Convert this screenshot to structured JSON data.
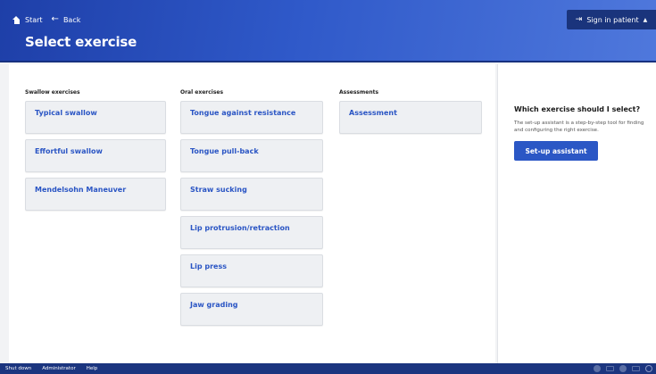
{
  "header": {
    "nav": {
      "start": "Start",
      "back": "Back"
    },
    "title": "Select exercise",
    "sign_in": "Sign in patient"
  },
  "columns": {
    "swallow": {
      "label": "Swallow exercises",
      "items": [
        "Typical swallow",
        "Effortful swallow",
        "Mendelsohn Maneuver"
      ]
    },
    "oral": {
      "label": "Oral exercises",
      "items": [
        "Tongue against resistance",
        "Tongue pull-back",
        "Straw sucking",
        "Lip protrusion/retraction",
        "Lip press",
        "Jaw grading"
      ]
    },
    "assessments": {
      "label": "Assessments",
      "items": [
        "Assessment"
      ]
    }
  },
  "aside": {
    "title": "Which exercise should I select?",
    "text": "The set-up assistant is a step-by-step tool for finding and configuring the right exercise.",
    "button": "Set-up assistant"
  },
  "footer": {
    "items": [
      "Shut down",
      "Administrator",
      "Help"
    ]
  },
  "colors": {
    "header": "#2f59c9",
    "accent": "#2b57c5",
    "footer": "#1b357f"
  },
  "icons": [
    "home-icon",
    "back-arrow-icon",
    "sign-in-icon",
    "caret-icon"
  ]
}
